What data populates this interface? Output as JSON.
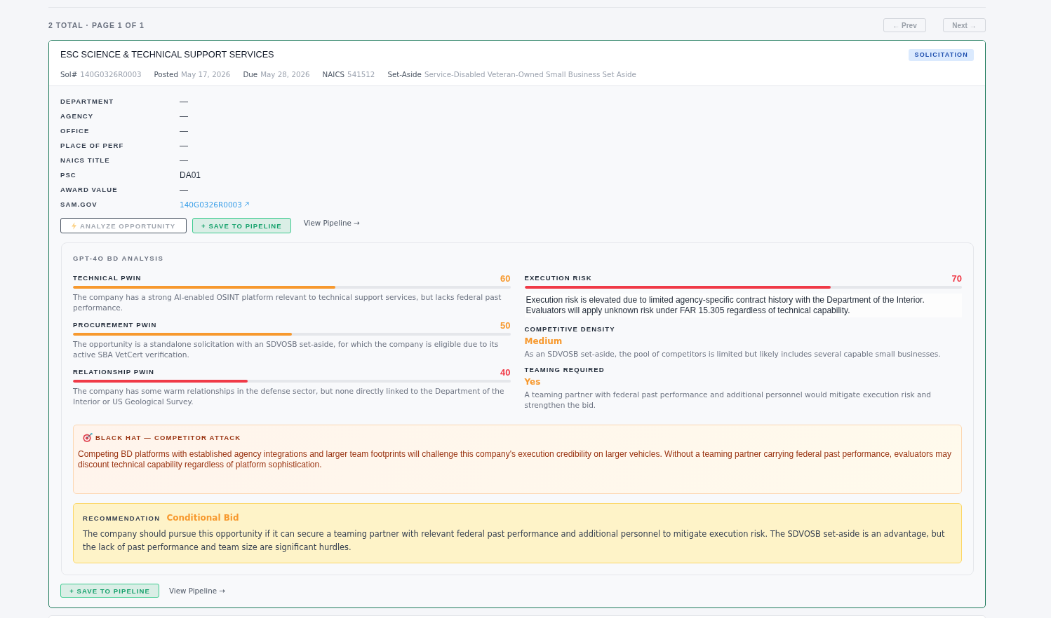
{
  "pagination": {
    "summary": "2 TOTAL · PAGE 1 OF 1",
    "buttons": [
      {
        "label": "← Prev",
        "disabled": true
      },
      {
        "label": "Next →",
        "disabled": true
      }
    ]
  },
  "opportunity": {
    "title": "ESC SCIENCE & TECHNICAL SUPPORT SERVICES",
    "type_badge": "SOLICITATION",
    "meta": [
      {
        "label": "Sol#",
        "value": "140G0326R0003"
      },
      {
        "label": "Posted",
        "value": "May 17, 2026"
      },
      {
        "label": "Due",
        "value": "May 28, 2026"
      },
      {
        "label": "NAICS",
        "value": "541512"
      },
      {
        "label": "Set-Aside",
        "value": "Service-Disabled Veteran-Owned Small Business Set Aside"
      }
    ],
    "details": [
      {
        "label": "DEPARTMENT",
        "value": "—",
        "kind": "text"
      },
      {
        "label": "AGENCY",
        "value": "—",
        "kind": "text"
      },
      {
        "label": "OFFICE",
        "value": "—",
        "kind": "text"
      },
      {
        "label": "PLACE OF PERF",
        "value": "—",
        "kind": "text"
      },
      {
        "label": "NAICS TITLE",
        "value": "—",
        "kind": "text"
      },
      {
        "label": "PSC",
        "value": "DA01",
        "kind": "text"
      },
      {
        "label": "AWARD VALUE",
        "value": "—",
        "kind": "text"
      },
      {
        "label": "SAM.GOV",
        "value": "140G0326R0003",
        "kind": "link"
      }
    ],
    "actions": [
      {
        "kind": "analyze",
        "label": "ANALYZE OPPORTUNITY",
        "disabled": true
      },
      {
        "kind": "save",
        "label": "+ SAVE TO PIPELINE",
        "disabled": false
      },
      {
        "kind": "link",
        "label": "View Pipeline →",
        "disabled": false
      }
    ],
    "analysis": {
      "title": "GPT-4O BD ANALYSIS",
      "columns": [
        {
          "items": [
            {
              "kind": "score",
              "label": "TECHNICAL PWIN",
              "value": "60",
              "level": 0.6,
              "color": "#f7992e",
              "highlighted": false,
              "text": "The company has a strong AI-enabled OSINT platform relevant to technical support services, but lacks federal past performance."
            },
            {
              "kind": "score",
              "label": "PROCUREMENT PWIN",
              "value": "50",
              "level": 0.5,
              "color": "#f7992e",
              "highlighted": false,
              "text": "The opportunity is a standalone solicitation with an SDVOSB set-aside, for which the company is eligible due to its active SBA VetCert verification."
            },
            {
              "kind": "score",
              "label": "RELATIONSHIP PWIN",
              "value": "40",
              "level": 0.4,
              "color": "#f03a47",
              "highlighted": false,
              "text": "The company has some warm relationships in the defense sector, but none directly linked to the Department of the Interior or US Geological Survey."
            }
          ]
        },
        {
          "items": [
            {
              "kind": "score",
              "label": "EXECUTION RISK",
              "value": "70",
              "level": 0.7,
              "color": "#f03a47",
              "highlighted": true,
              "text": "Execution risk is elevated due to limited agency-specific contract history with the Department of the Interior. Evaluators will apply unknown risk under FAR 15.305 regardless of technical capability."
            },
            {
              "kind": "rating",
              "label": "COMPETITIVE DENSITY",
              "value": "Medium",
              "highlighted": false,
              "text": "As an SDVOSB set-aside, the pool of competitors is limited but likely includes several capable small businesses."
            },
            {
              "kind": "rating",
              "label": "TEAMING REQUIRED",
              "value": "Yes",
              "highlighted": false,
              "text": "A teaming partner with federal past performance and additional personnel would mitigate execution risk and strengthen the bid."
            }
          ]
        }
      ],
      "competitor_attack": {
        "title": "BLACK HAT — COMPETITOR ATTACK",
        "text": "Competing BD platforms with established agency integrations and larger team footprints will challenge this company's execution credibility on larger vehicles. Without a teaming partner carrying federal past performance, evaluators may discount technical capability regardless of platform sophistication."
      },
      "recommendation": {
        "label": "RECOMMENDATION",
        "verdict": "Conditional Bid",
        "text": "The company should pursue this opportunity if it can secure a teaming partner with relevant federal past performance and additional personnel to mitigate execution risk. The SDVOSB set-aside is an advantage, but the lack of past performance and team size are significant hurdles."
      }
    },
    "footer_actions": [
      {
        "kind": "save",
        "label": "+ SAVE TO PIPELINE"
      },
      {
        "kind": "link",
        "label": "View Pipeline →"
      }
    ]
  }
}
